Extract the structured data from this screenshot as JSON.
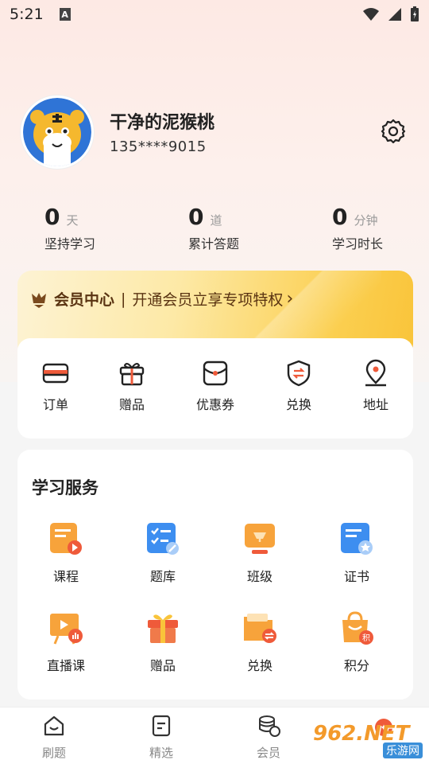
{
  "status_bar": {
    "time": "5:21",
    "a_badge": "A"
  },
  "profile": {
    "nickname": "干净的泥猴桃",
    "phone": "135****9015"
  },
  "stats": [
    {
      "num": "0",
      "unit": "天",
      "label": "坚持学习"
    },
    {
      "num": "0",
      "unit": "道",
      "label": "累计答题"
    },
    {
      "num": "0",
      "unit": "分钟",
      "label": "学习时长"
    }
  ],
  "vip": {
    "title": "会员中心",
    "separator": "|",
    "desc": "开通会员立享专项特权",
    "arrow": "›"
  },
  "orders": [
    {
      "label": "订单",
      "icon": "wallet-icon"
    },
    {
      "label": "赠品",
      "icon": "gift-icon"
    },
    {
      "label": "优惠券",
      "icon": "coupon-icon"
    },
    {
      "label": "兑换",
      "icon": "exchange-shield-icon"
    },
    {
      "label": "地址",
      "icon": "location-icon"
    }
  ],
  "services": {
    "title": "学习服务",
    "items": [
      {
        "label": "课程",
        "icon": "course-icon"
      },
      {
        "label": "题库",
        "icon": "question-bank-icon"
      },
      {
        "label": "班级",
        "icon": "class-icon"
      },
      {
        "label": "证书",
        "icon": "certificate-icon"
      },
      {
        "label": "直播课",
        "icon": "live-class-icon"
      },
      {
        "label": "赠品",
        "icon": "gift-box-icon"
      },
      {
        "label": "兑换",
        "icon": "exchange-folder-icon"
      },
      {
        "label": "积分",
        "icon": "points-bag-icon"
      }
    ]
  },
  "tabbar": [
    {
      "label": "刷题",
      "icon": "home-icon"
    },
    {
      "label": "精选",
      "icon": "selected-icon"
    },
    {
      "label": "会员",
      "icon": "vip-coins-icon"
    }
  ],
  "watermark": {
    "big": "962.NET",
    "small": "乐游网"
  },
  "colors": {
    "accent": "#f39a2b",
    "vip_text": "#5a3412",
    "tab_text": "#888888"
  }
}
